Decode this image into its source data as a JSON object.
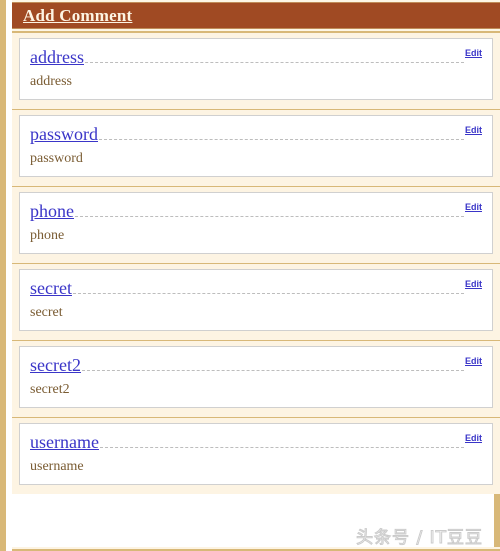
{
  "header": {
    "title": "Add Comment",
    "bar_color": "#a04a23",
    "text_color": "#fdf4e3"
  },
  "theme": {
    "frame_border": "#d8b878",
    "card_strip_bg": "#fdf4e3",
    "card_bg": "#ffffff",
    "card_border": "#d0d0d0",
    "link_color": "#3a35c8",
    "desc_color": "#7a5c33",
    "dotted_rule_color": "#bdbdbd"
  },
  "edit_label": "Edit",
  "cards": [
    {
      "title": "address",
      "description": "address",
      "edit_label": "Edit"
    },
    {
      "title": "password",
      "description": "password",
      "edit_label": "Edit"
    },
    {
      "title": "phone",
      "description": "phone",
      "edit_label": "Edit"
    },
    {
      "title": "secret",
      "description": "secret",
      "edit_label": "Edit"
    },
    {
      "title": "secret2",
      "description": "secret2",
      "edit_label": "Edit"
    },
    {
      "title": "username",
      "description": "username",
      "edit_label": "Edit"
    }
  ],
  "watermark": {
    "text": "头条号 / IT豆豆"
  }
}
